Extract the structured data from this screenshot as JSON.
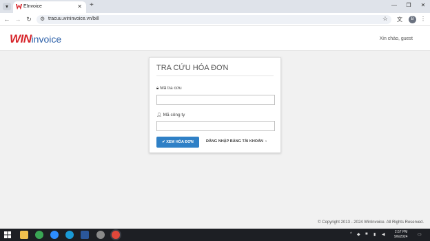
{
  "browser": {
    "tab_title": "EInvoice",
    "url": "tracuu.wininvoice.vn/bill",
    "new_tab_label": "+",
    "close_tab_label": "✕",
    "profile_initial": "B"
  },
  "header": {
    "logo_win": "WIN",
    "logo_invoice": "invoice",
    "greeting": "Xin chào, guest"
  },
  "form": {
    "title": "TRA CỨU HÓA ĐƠN",
    "lookup_label": "Mã tra cứu",
    "lookup_value": "",
    "company_label": "Mã công ty",
    "company_value": "",
    "submit_label": "XEM HÓA ĐƠN",
    "login_link_label": "ĐĂNG NHẬP BẰNG TÀI KHOẢN"
  },
  "footer": {
    "copyright": "© Copyright 2013 - 2024 WinInvoice. All Rights Reserved."
  },
  "taskbar": {
    "time": "2:57 PM",
    "date": "9/6/2024"
  },
  "colors": {
    "brand_red": "#d7262c",
    "brand_blue": "#2b5fa8",
    "primary_button": "#2f80c6"
  }
}
